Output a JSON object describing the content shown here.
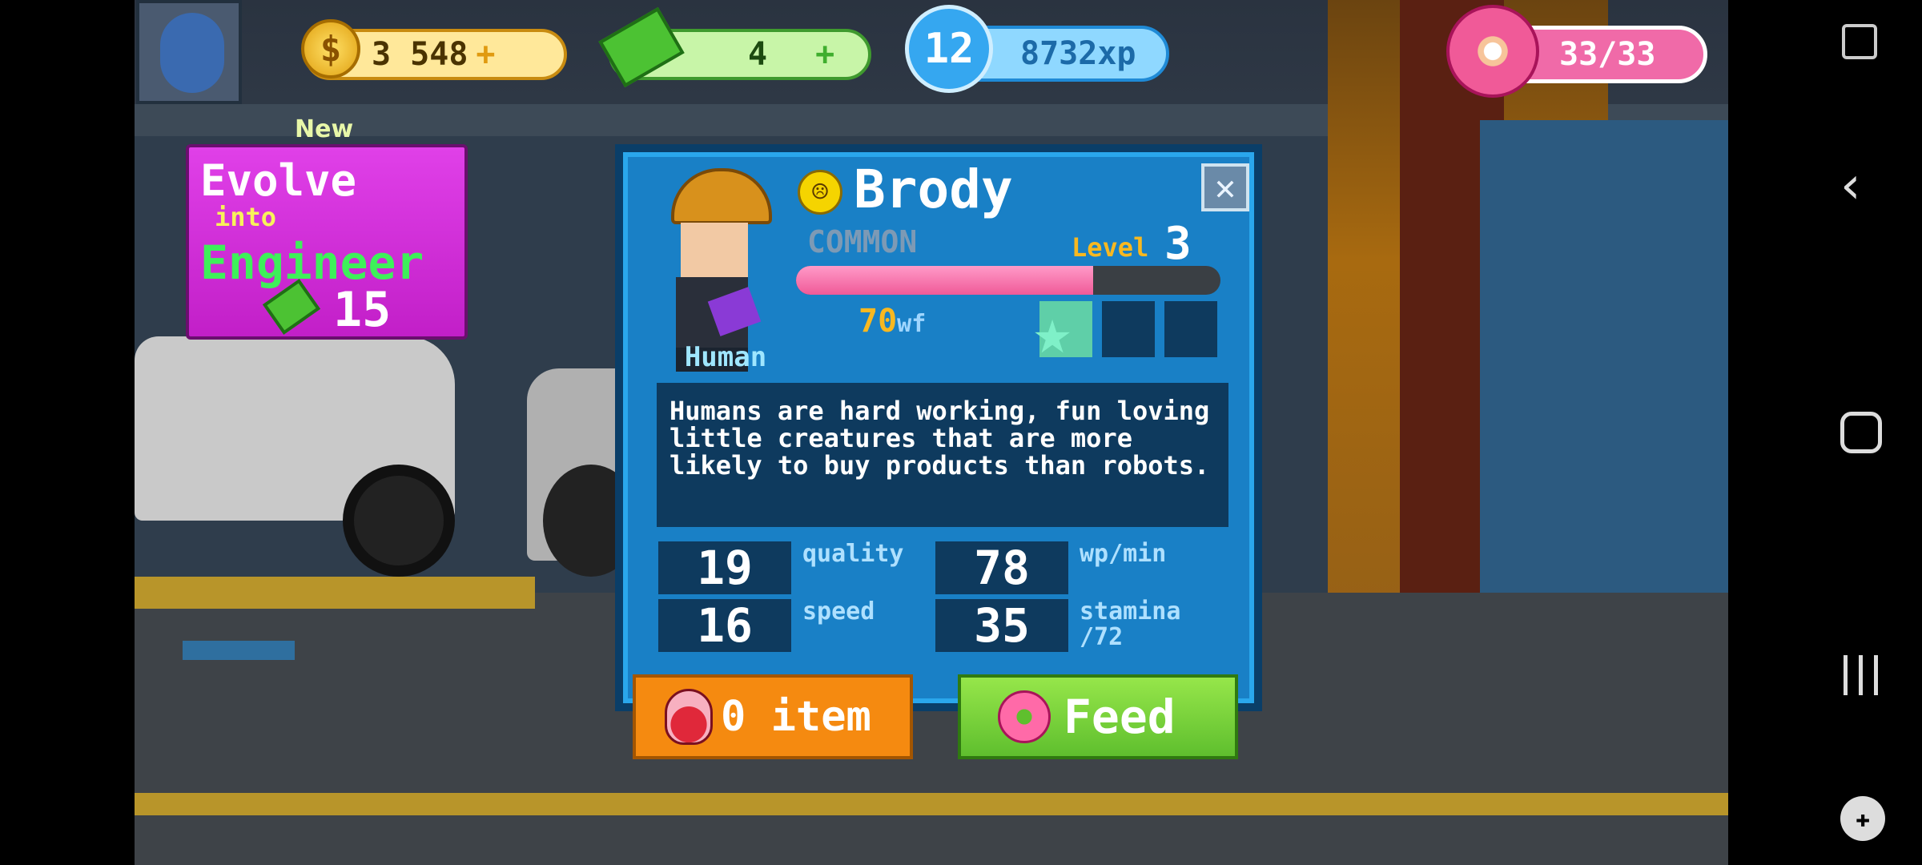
{
  "hud": {
    "coins": "3 548",
    "coins_plus": "+",
    "coins_icon": "dollar-coin-icon",
    "cash": "4",
    "cash_plus": "+",
    "xp_level": "12",
    "xp": "8732xp",
    "donuts": "33/33"
  },
  "evolve_card": {
    "badge": "New",
    "line1": "Evolve",
    "line2": "into",
    "line3": "Engineer",
    "cost": "15"
  },
  "dialog": {
    "name": "Brody",
    "rarity": "COMMON",
    "level_label": "Level",
    "level_value": "3",
    "level_progress": 0.7,
    "wf_value": "70",
    "wf_unit": "wf",
    "species": "Human",
    "mood_icon": "sad-face-icon",
    "description": "Humans are hard working, fun loving little creatures that are more likely to buy products than robots.",
    "stats": {
      "quality_value": "19",
      "quality_label": "quality",
      "wpmin_value": "78",
      "wpmin_label": "wp/min",
      "speed_value": "16",
      "speed_label": "speed",
      "stamina_value": "35",
      "stamina_label": "stamina",
      "stamina_max": "/72"
    },
    "item_button": "0 item",
    "feed_button": "Feed"
  },
  "colors": {
    "dialog_bg": "#1980c6",
    "evolve_card": "#d629d6",
    "item_button": "#f58a10",
    "feed_button": "#7ad63a",
    "donut_pill": "#f06aa8"
  }
}
